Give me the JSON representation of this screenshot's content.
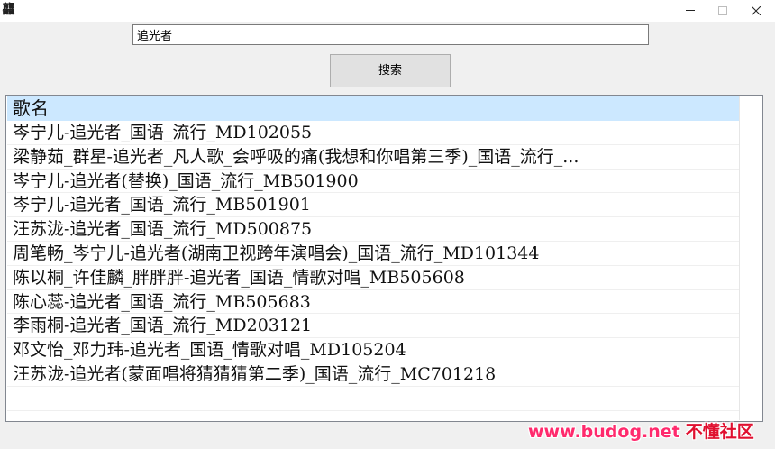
{
  "window": {
    "icon_glyph": "龘",
    "minimize_icon": "minimize-icon",
    "maximize_icon": "maximize-icon",
    "close_icon": "close-icon"
  },
  "search": {
    "value": "追光者"
  },
  "search_button": {
    "label": "搜索"
  },
  "list": {
    "header": "歌名",
    "items": [
      "岑宁儿-追光者_国语_流行_MD102055",
      "梁静茹_群星-追光者_凡人歌_会呼吸的痛(我想和你唱第三季)_国语_流行_...",
      "岑宁儿-追光者(替换)_国语_流行_MB501900",
      "岑宁儿-追光者_国语_流行_MB501901",
      "汪苏泷-追光者_国语_流行_MD500875",
      "周笔畅_岑宁儿-追光者(湖南卫视跨年演唱会)_国语_流行_MD101344",
      "陈以桐_许佳麟_胖胖胖-追光者_国语_情歌对唱_MB505608",
      "陈心蕊-追光者_国语_流行_MB505683",
      "李雨桐-追光者_国语_流行_MD203121",
      "邓文怡_邓力玮-追光者_国语_情歌对唱_MD105204",
      "汪苏泷-追光者(蒙面唱将猜猜猜第二季)_国语_流行_MC701218"
    ]
  },
  "watermark": {
    "url": "www.budog.net",
    "cn": "不懂社区"
  },
  "colors": {
    "header_highlight": "#cce8ff",
    "window_bg": "#f0f0f0",
    "watermark": "#ff2a6d"
  }
}
